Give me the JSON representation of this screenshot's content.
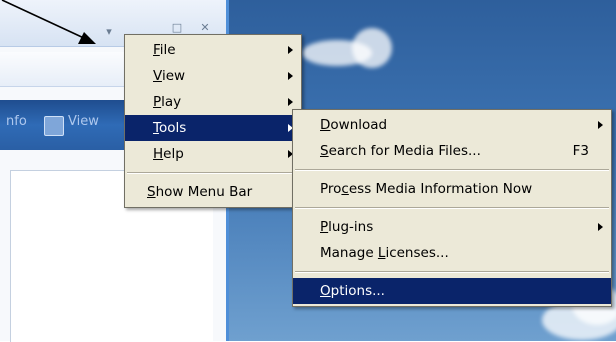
{
  "player_window": {
    "toolbar_text": "nfo",
    "toolbar_view": "View",
    "title_buttons": {
      "minimize": "▾",
      "restore": "□",
      "close": "✕"
    }
  },
  "main_menu": {
    "items": [
      {
        "label": "File",
        "mnemonic": "F",
        "rest": "ile",
        "submenu": true
      },
      {
        "label": "View",
        "mnemonic": "V",
        "rest": "iew",
        "submenu": true
      },
      {
        "label": "Play",
        "mnemonic": "P",
        "rest": "lay",
        "submenu": true
      },
      {
        "label": "Tools",
        "mnemonic": "T",
        "rest": "ools",
        "submenu": true,
        "selected": true
      },
      {
        "label": "Help",
        "mnemonic": "H",
        "rest": "elp",
        "submenu": true
      }
    ],
    "show_menu_bar": {
      "label": "Show Menu Bar",
      "mnemonic": "S",
      "rest": "how Menu Bar"
    }
  },
  "tools_menu": {
    "download": {
      "label": "Download",
      "mnemonic": "D",
      "rest": "ownload"
    },
    "search": {
      "label": "Search for Media Files...",
      "mnemonic": "S",
      "rest": "earch for Media Files...",
      "shortcut": "F3"
    },
    "process": {
      "pre": "Pro",
      "mnemonic": "c",
      "rest": "ess Media Information Now",
      "label": "Process Media Information Now"
    },
    "plugins": {
      "label": "Plug-ins",
      "mnemonic": "P",
      "rest": "lug-ins"
    },
    "licenses": {
      "pre": "Manage ",
      "mnemonic": "L",
      "rest": "icenses...",
      "label": "Manage Licenses..."
    },
    "options": {
      "label": "Options...",
      "mnemonic": "O",
      "rest": "ptions...",
      "selected": true
    }
  },
  "colors": {
    "menu_bg": "#ece9d8",
    "menu_highlight": "#0a246a",
    "desktop_sky": "#3d74b3"
  }
}
